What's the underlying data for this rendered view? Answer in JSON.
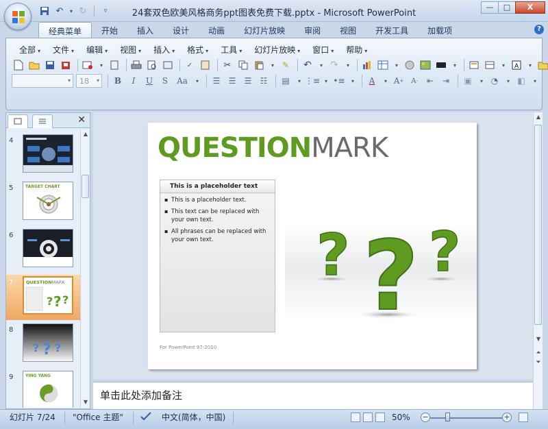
{
  "window": {
    "title": "24套双色欧美风格商务ppt图表免费下载.pptx - Microsoft PowerPoint",
    "minimize": "—",
    "restore": "□",
    "close": "X"
  },
  "ribbon_tabs": [
    "经典菜单",
    "开始",
    "插入",
    "设计",
    "动画",
    "幻灯片放映",
    "审阅",
    "视图",
    "开发工具",
    "加载项"
  ],
  "active_tab": "经典菜单",
  "help": "?",
  "menus": [
    "全部",
    "文件",
    "编辑",
    "视图",
    "插入",
    "格式",
    "工具",
    "幻灯片放映",
    "窗口",
    "帮助"
  ],
  "format_toolbar": {
    "font_name": "",
    "font_size": "18"
  },
  "slides_pane": {
    "thumbnails": [
      {
        "number": "4"
      },
      {
        "number": "5",
        "title": "TARGET CHART"
      },
      {
        "number": "6"
      },
      {
        "number": "7",
        "title_a": "QUESTION",
        "title_b": "MARK",
        "selected": true
      },
      {
        "number": "8"
      },
      {
        "number": "9",
        "title": "YING YANG"
      }
    ]
  },
  "slide": {
    "title_part1": "QUESTION",
    "title_part2": "MARK",
    "box_heading": "This is a placeholder text",
    "bullets": [
      "This is a placeholder text.",
      "This text can be replaced with your own text.",
      "All phrases can be replaced with your own text."
    ],
    "footer": "For PowerPoint 97-2010"
  },
  "notes": {
    "placeholder": "单击此处添加备注"
  },
  "statusbar": {
    "slide_counter": "幻灯片 7/24",
    "theme": "\"Office 主题\"",
    "language": "中文(简体，中国)",
    "zoom": "50%"
  },
  "colors": {
    "green": "#5f9a21",
    "dark_green": "#3f7015",
    "gray": "#6b6b6b",
    "selection": "#f0a763"
  }
}
